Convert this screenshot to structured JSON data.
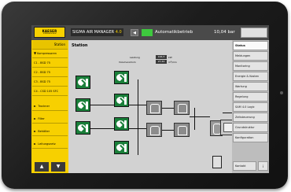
{
  "topbar": {
    "logo_main": "KAESER",
    "logo_sub": "KOMPRESSOREN",
    "system_name": "SIGMA AIR MANAGER",
    "system_version": "4.0",
    "back_button": "◀",
    "status_text": "Automatikbetrieb",
    "pressure": "10,04 bar"
  },
  "leftmenu": {
    "header": "Station",
    "items": [
      {
        "label": "Kompressoren",
        "arrow": "▼"
      },
      {
        "label": "C1 - BSD 75",
        "arrow": ""
      },
      {
        "label": "C2 - BSD 75",
        "arrow": ""
      },
      {
        "label": "C3 - BSD 75",
        "arrow": ""
      },
      {
        "label": "C4 - CSD 105 SFC",
        "arrow": ""
      },
      {
        "label": "Trockner",
        "arrow": "►"
      },
      {
        "label": "Filter",
        "arrow": "►"
      },
      {
        "label": "Behälter",
        "arrow": "►"
      },
      {
        "label": "Leitungsnetz",
        "arrow": "►"
      }
    ],
    "nav_up": "▲",
    "nav_down": "▼"
  },
  "main": {
    "title": "Station",
    "leistung_label": "Leistung",
    "leistung_value": "163,3",
    "leistung_unit": "kW",
    "volumen_label": "Volumenstrom",
    "volumen_value": "27,44",
    "volumen_unit": "m³/min"
  },
  "rightmenu": {
    "items": [
      {
        "label": "Status",
        "active": true
      },
      {
        "label": "Meldungen",
        "active": false
      },
      {
        "label": "Monitoring",
        "active": false
      },
      {
        "label": "Energie & Kosten",
        "active": false
      },
      {
        "label": "Wartung",
        "active": false
      },
      {
        "label": "Regelung",
        "active": false
      },
      {
        "label": "SAM 4.0 Logic",
        "active": false
      },
      {
        "label": "Zeitsteuerung",
        "active": false
      },
      {
        "label": "Grundstruktur",
        "active": false
      },
      {
        "label": "Konfiguration",
        "active": false
      },
      {
        "label": "Kontakt",
        "active": false
      }
    ],
    "info_button": "i"
  },
  "colors": {
    "kaeser_yellow": "#f7d000",
    "running_green": "#1a7f3a",
    "status_led": "#3ec93e"
  }
}
